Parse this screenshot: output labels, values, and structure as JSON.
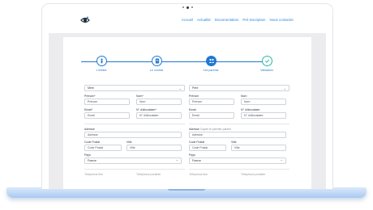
{
  "nav": {
    "links": [
      "Accueil",
      "Actualité",
      "Documentation",
      "Pré-inscription",
      "Nous contacter"
    ]
  },
  "stepper": {
    "steps": [
      {
        "label": "L'enfant",
        "state": "completed",
        "icon": "child-icon"
      },
      {
        "label": "Le contrat",
        "state": "completed",
        "icon": "document-icon"
      },
      {
        "label": "Les parents",
        "state": "active",
        "icon": "parents-icon"
      },
      {
        "label": "Validation",
        "state": "pending",
        "icon": "checkmark-icon"
      }
    ],
    "colors": {
      "primary": "#1f78d1",
      "validation": "#2fb5a2"
    }
  },
  "parent1": {
    "relation": "Mère",
    "prenom_label": "Prénom*",
    "prenom_placeholder": "Prénom",
    "nom_label": "Nom*",
    "nom_placeholder": "Nom",
    "email_label": "Email*",
    "email_placeholder": "Email",
    "alloc_label": "N° d'allocataire*",
    "alloc_placeholder": "N° d'allocataire",
    "adresse_label": "Adresse",
    "adresse_placeholder": "Adresse",
    "cp_label": "Code Postal",
    "cp_placeholder": "Code Postal",
    "ville_label": "Ville",
    "ville_placeholder": "Ville",
    "pays_label": "Pays",
    "pays_value": "France",
    "tel_fixe_label": "Téléphone fixe",
    "tel_mobile_label": "Téléphone portable"
  },
  "parent2": {
    "relation": "Père",
    "prenom_label": "Prénom",
    "prenom_placeholder": "Prénom",
    "nom_label": "Nom",
    "nom_placeholder": "Nom",
    "email_label": "Email",
    "email_placeholder": "Email",
    "alloc_label": "N° d'allocataire",
    "alloc_placeholder": "N° d'allocataire",
    "adresse_label": "Adresse",
    "adresse_hint": "Copier le premier parent",
    "adresse_placeholder": "Adresse",
    "cp_label": "Code Postal",
    "cp_placeholder": "Code Postal",
    "ville_label": "Ville",
    "ville_placeholder": "Ville",
    "pays_label": "Pays",
    "pays_value": "France",
    "tel_fixe_label": "Téléphone fixe",
    "tel_mobile_label": "Téléphone portable"
  }
}
